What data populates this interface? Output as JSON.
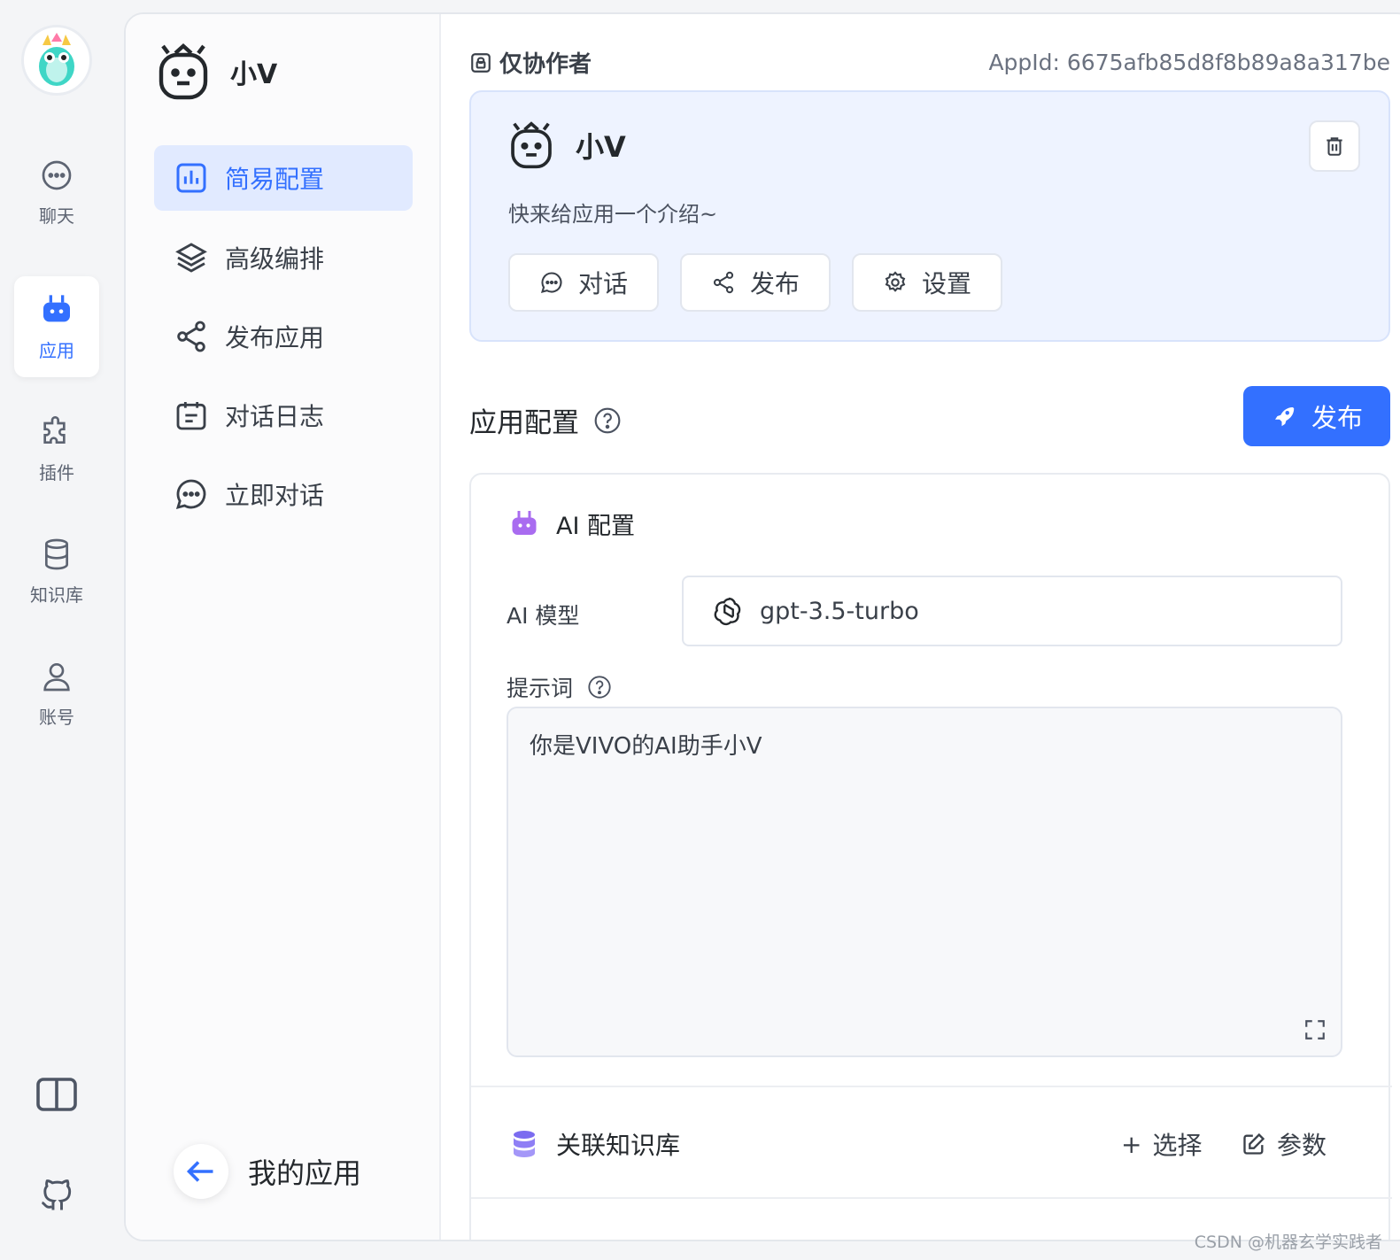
{
  "nav": {
    "items": [
      {
        "label": "聊天",
        "icon": "chat-icon"
      },
      {
        "label": "应用",
        "icon": "robot-icon"
      },
      {
        "label": "插件",
        "icon": "puzzle-icon"
      },
      {
        "label": "知识库",
        "icon": "database-icon"
      },
      {
        "label": "账号",
        "icon": "user-icon"
      }
    ],
    "active": "应用",
    "bottom": [
      {
        "icon": "book-icon"
      },
      {
        "icon": "github-icon"
      }
    ]
  },
  "side": {
    "app_name": "小V",
    "menu": [
      {
        "label": "简易配置",
        "icon": "chart-bar-icon"
      },
      {
        "label": "高级编排",
        "icon": "layers-icon"
      },
      {
        "label": "发布应用",
        "icon": "share-icon"
      },
      {
        "label": "对话日志",
        "icon": "calendar-log-icon"
      },
      {
        "label": "立即对话",
        "icon": "chat-icon"
      }
    ],
    "active": "简易配置",
    "back_label": "我的应用"
  },
  "header": {
    "permission": "仅协作者",
    "app_id": "AppId: 6675afb85d8f8b89a8a317be"
  },
  "card": {
    "name": "小V",
    "intro": "快来给应用一个介绍~",
    "buttons": {
      "chat": "对话",
      "publish": "发布",
      "settings": "设置"
    }
  },
  "config": {
    "title": "应用配置",
    "publish_label": "发布",
    "ai_title": "AI 配置",
    "model_label": "AI 模型",
    "model_value": "gpt-3.5-turbo",
    "prompt_label": "提示词",
    "prompt_value": "你是VIVO的AI助手小V",
    "kb_title": "关联知识库",
    "kb_select": "选择",
    "kb_params": "参数"
  },
  "colors": {
    "accent": "#3370ff",
    "purple": "#8b5cf6"
  },
  "watermark": "CSDN @机器玄学实践者"
}
